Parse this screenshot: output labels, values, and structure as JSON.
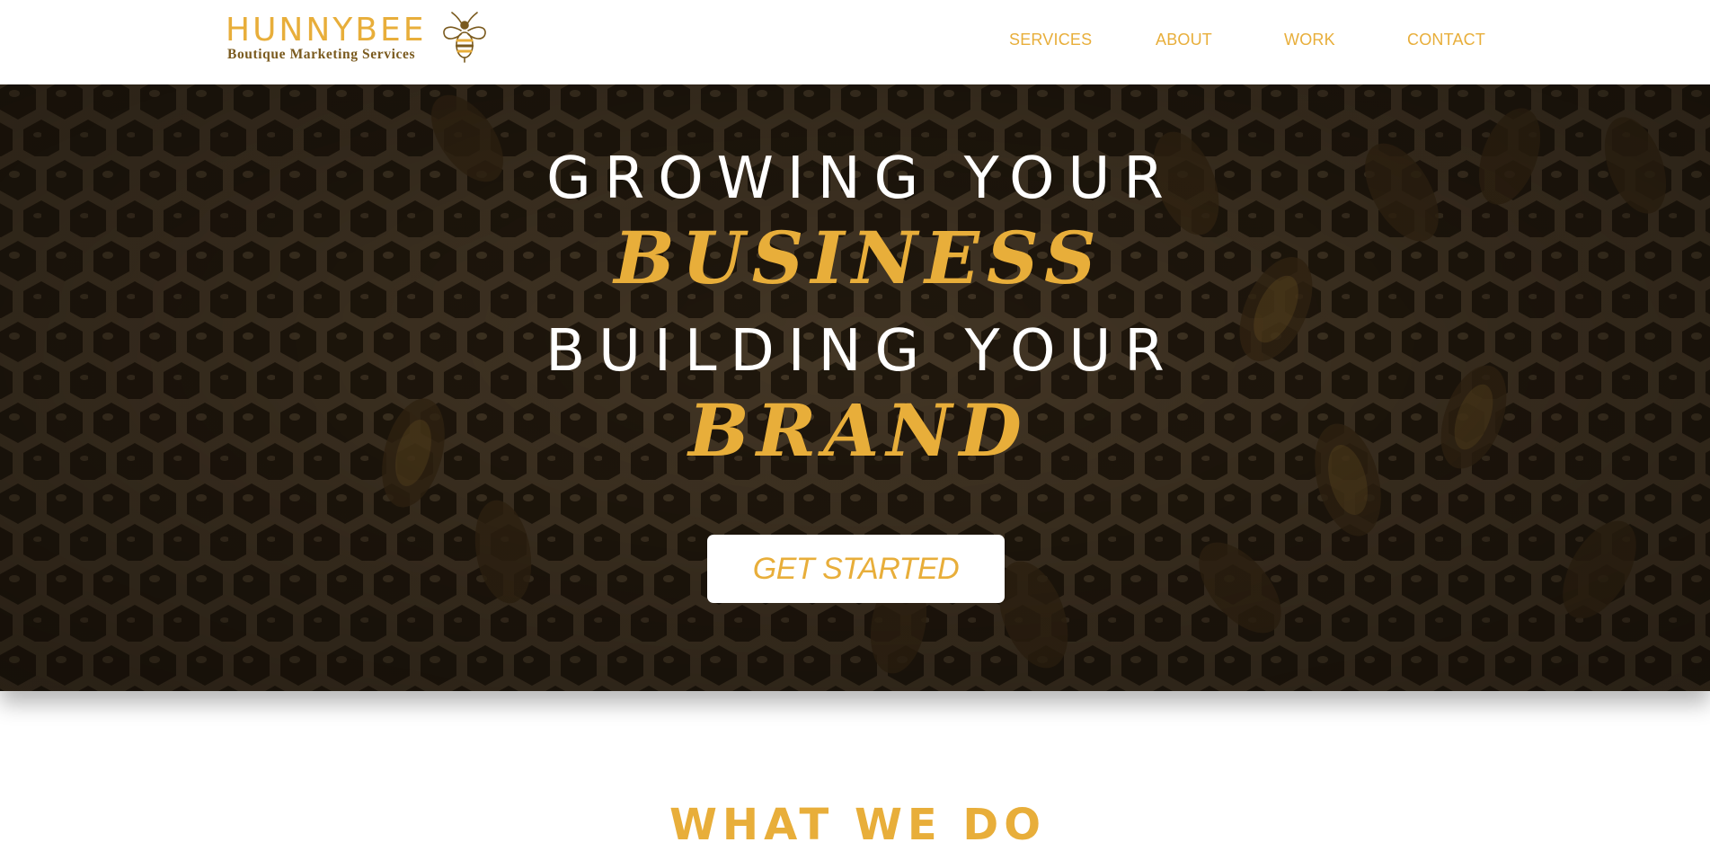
{
  "brand": {
    "name": "HUNNYBEE",
    "tagline": "Boutique Marketing Services",
    "logo_icon": "bee-icon"
  },
  "nav": {
    "items": [
      {
        "label": "SERVICES"
      },
      {
        "label": "ABOUT"
      },
      {
        "label": "WORK"
      },
      {
        "label": "CONTACT"
      }
    ]
  },
  "hero": {
    "background": "honeycomb-with-bees-photo",
    "line1": "GROWING YOUR",
    "line2": "BUSINESS",
    "line3": "BUILDING YOUR",
    "line4": "BRAND",
    "cta_label": "GET STARTED"
  },
  "section": {
    "title": "WHAT WE DO"
  },
  "colors": {
    "accent": "#e8ae3a",
    "brand_brown": "#7a5a1e",
    "hero_dark": "#2a2014",
    "white": "#ffffff"
  }
}
